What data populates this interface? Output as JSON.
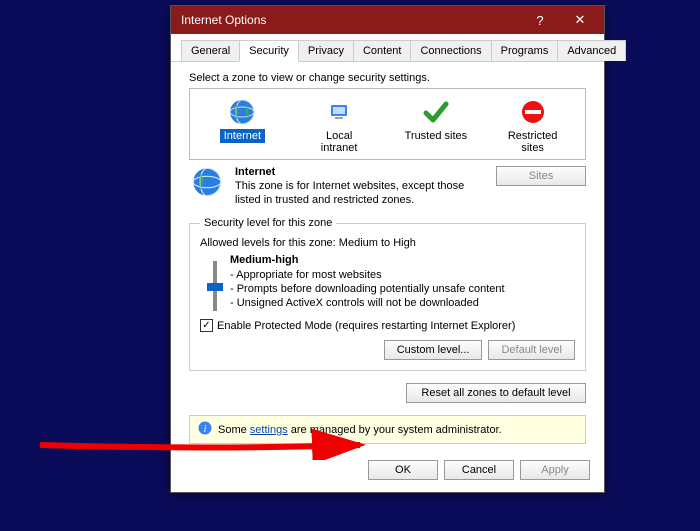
{
  "dialog": {
    "title": "Internet Options"
  },
  "tabs": [
    "General",
    "Security",
    "Privacy",
    "Content",
    "Connections",
    "Programs",
    "Advanced"
  ],
  "active_tab": 1,
  "zone_prompt": "Select a zone to view or change security settings.",
  "zones": [
    {
      "label": "Internet",
      "selected": true
    },
    {
      "label": "Local intranet",
      "selected": false
    },
    {
      "label": "Trusted sites",
      "selected": false
    },
    {
      "label": "Restricted sites",
      "selected": false
    }
  ],
  "zone_desc": {
    "title": "Internet",
    "body": "This zone is for Internet websites, except those listed in trusted and restricted zones.",
    "sites_button": "Sites"
  },
  "level": {
    "legend": "Security level for this zone",
    "allowed": "Allowed levels for this zone: Medium to High",
    "name": "Medium-high",
    "b1": "- Appropriate for most websites",
    "b2": "- Prompts before downloading potentially unsafe content",
    "b3": "- Unsigned ActiveX controls will not be downloaded",
    "protected_mode": "Enable Protected Mode (requires restarting Internet Explorer)",
    "custom_btn": "Custom level...",
    "default_btn": "Default level"
  },
  "reset_btn": "Reset all zones to default level",
  "info": {
    "prefix": "Some ",
    "link": "settings",
    "suffix": " are managed by your system administrator."
  },
  "footer": {
    "ok": "OK",
    "cancel": "Cancel",
    "apply": "Apply"
  },
  "watermark": ""
}
